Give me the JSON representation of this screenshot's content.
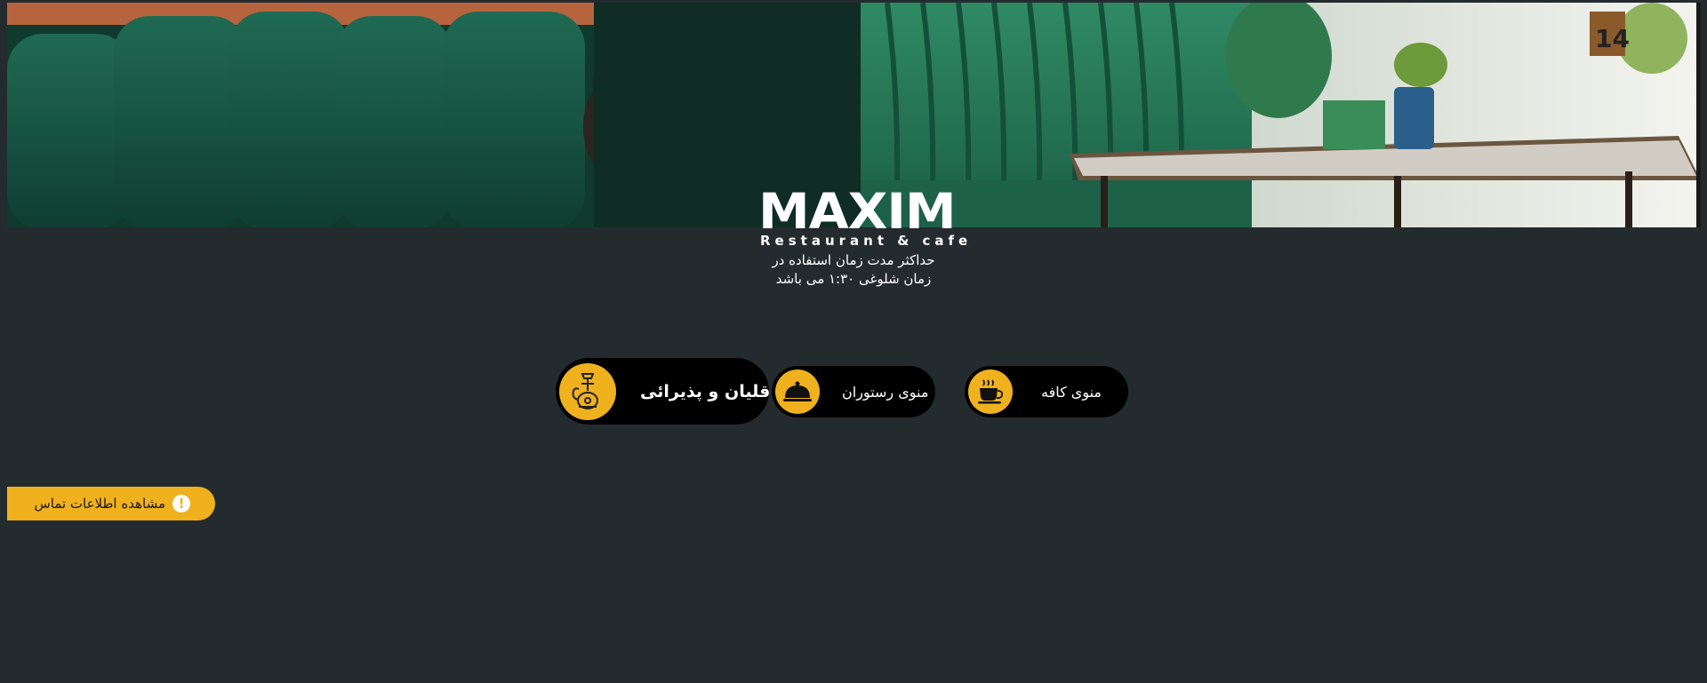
{
  "hero": {
    "image_description_icon": "restaurant-interior-photo-icon"
  },
  "logo": {
    "word": "MAXIM",
    "subtitle": "Restaurant & cafe"
  },
  "notice": {
    "line1": "حداکثر مدت زمان استفاده در",
    "line2": "زمان شلوغی ۱:۳۰ می باشد"
  },
  "menus": {
    "hookah": {
      "label": "قلیان و پذیرائی",
      "icon": "hookah-icon"
    },
    "restaurant": {
      "label": "منوی رستوران",
      "icon": "food-cloche-icon"
    },
    "cafe": {
      "label": "منوی کافه",
      "icon": "coffee-cup-icon"
    }
  },
  "contact": {
    "label": "مشاهده اطلاعات تماس",
    "icon": "exclamation-icon"
  },
  "colors": {
    "background": "#242b2f",
    "accent": "#f0b11e",
    "pill": "#000000",
    "text": "#ffffff"
  }
}
